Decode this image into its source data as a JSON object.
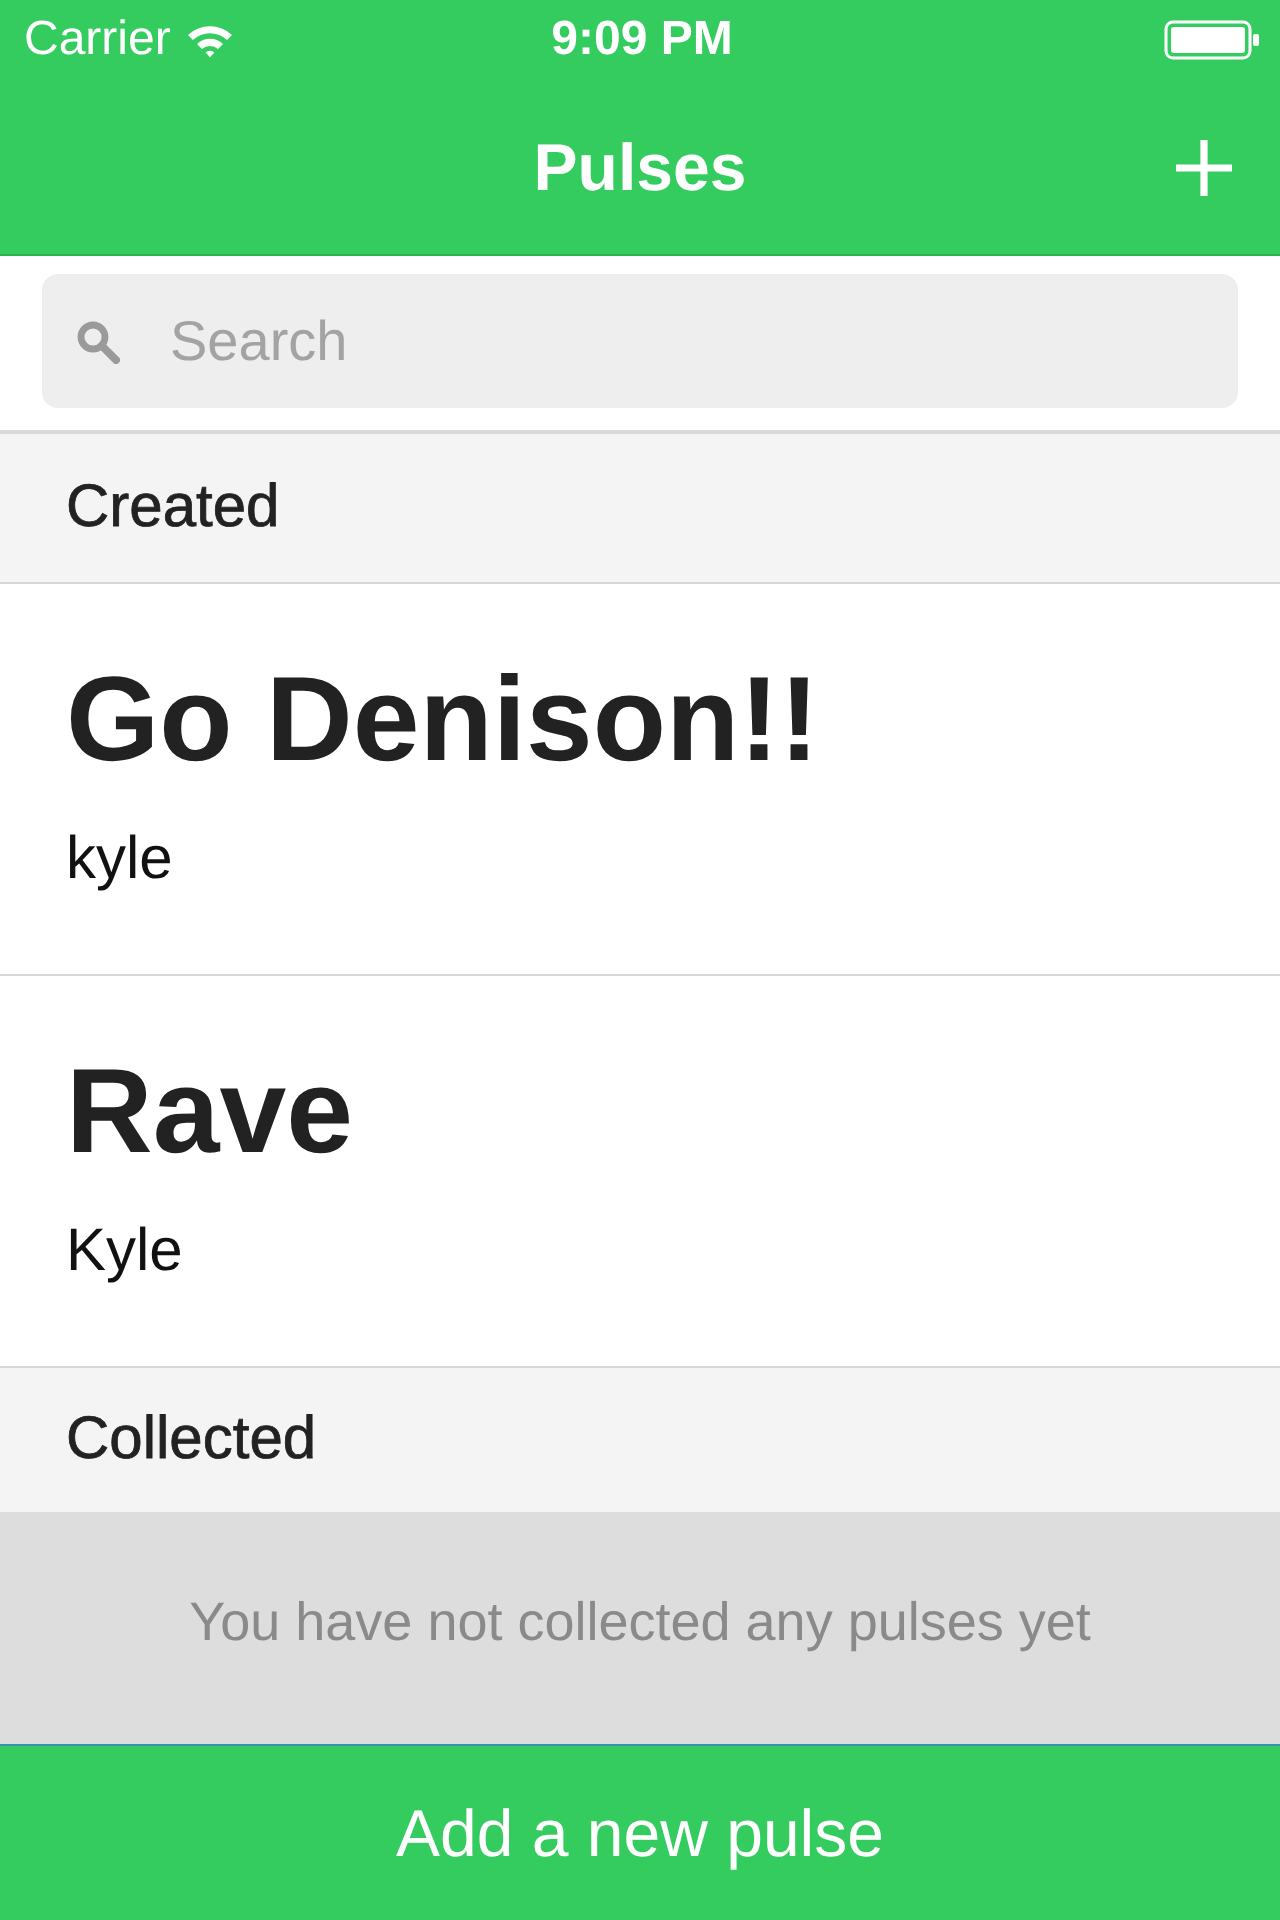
{
  "status_bar": {
    "carrier": "Carrier",
    "time": "9:09 PM"
  },
  "nav_bar": {
    "title": "Pulses"
  },
  "search": {
    "placeholder": "Search"
  },
  "sections": [
    {
      "title": "Created",
      "items": [
        {
          "title": "Go Denison!!",
          "author": "kyle"
        },
        {
          "title": "Rave",
          "author": "Kyle"
        }
      ]
    },
    {
      "title": "Collected",
      "empty_message": "You have not collected any pulses yet"
    }
  ],
  "bottom_button": {
    "label": "Add a new pulse"
  }
}
